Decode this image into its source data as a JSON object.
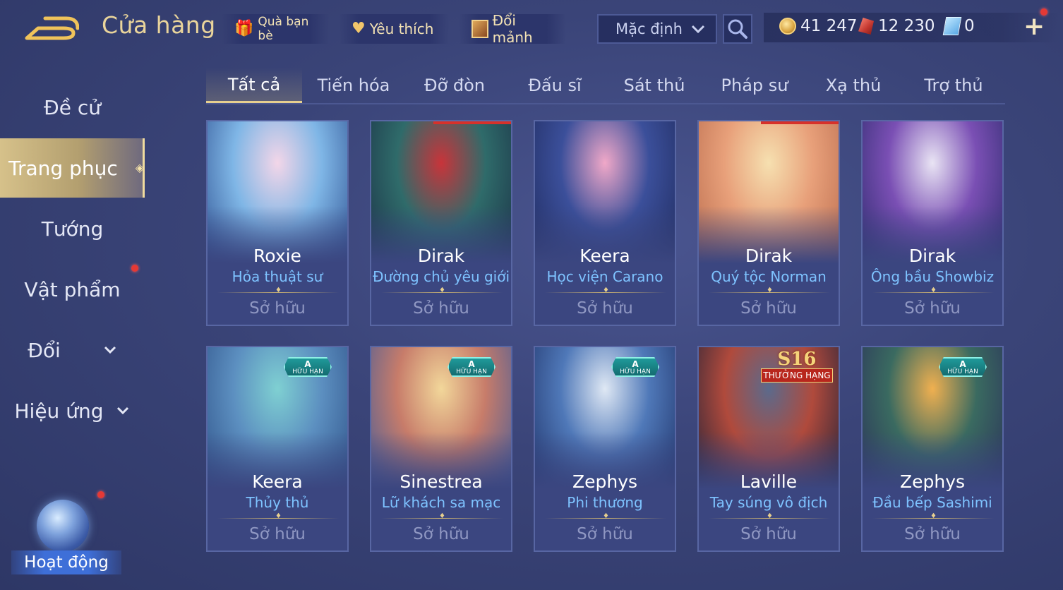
{
  "header": {
    "title": "Cửa hàng",
    "gift_label": "Quà bạn bè",
    "favorite_label": "Yêu thích",
    "fragment_label": "Đổi mảnh",
    "sort": {
      "selected": "Mặc định"
    },
    "currencies": {
      "gold": "41 247",
      "ruby": "12 230",
      "voucher": "0"
    }
  },
  "sidebar": {
    "items": [
      {
        "label": "Đề cử"
      },
      {
        "label": "Trang phục"
      },
      {
        "label": "Tướng"
      },
      {
        "label": "Vật phẩm"
      },
      {
        "label": "Đổi"
      },
      {
        "label": "Hiệu ứng"
      }
    ],
    "activity_label": "Hoạt động"
  },
  "tabs": [
    "Tất cả",
    "Tiến hóa",
    "Đỡ đòn",
    "Đấu sĩ",
    "Sát thủ",
    "Pháp sư",
    "Xạ thủ",
    "Trợ thủ"
  ],
  "badges": {
    "limited_top": "A",
    "limited_bottom": "HỮU HẠN",
    "season": "S16",
    "rank": "THƯỞNG HẠNG"
  },
  "cards": [
    {
      "hero": "Roxie",
      "skin": "Hỏa thuật sư",
      "status": "Sở hữu",
      "palette": [
        "#f3d6e8",
        "#7fb6e6",
        "#2c4e8f"
      ]
    },
    {
      "hero": "Dirak",
      "skin": "Đường chủ yêu giới",
      "status": "Sở hữu",
      "palette": [
        "#c8343a",
        "#2f6b6a",
        "#1a2f45"
      ]
    },
    {
      "hero": "Keera",
      "skin": "Học viện Carano",
      "status": "Sở hữu",
      "palette": [
        "#f0a8c8",
        "#3b4f9a",
        "#1f2a5c"
      ]
    },
    {
      "hero": "Dirak",
      "skin": "Quý tộc Norman",
      "status": "Sở hữu",
      "palette": [
        "#f6e0b0",
        "#e8a07a",
        "#b86a4c"
      ]
    },
    {
      "hero": "Dirak",
      "skin": "Ông bầu Showbiz",
      "status": "Sở hữu",
      "palette": [
        "#e9e4f4",
        "#7a4fb4",
        "#2a2a6a"
      ]
    },
    {
      "hero": "Keera",
      "skin": "Thủy thủ",
      "status": "Sở hữu",
      "palette": [
        "#7fd0d2",
        "#5c8fc0",
        "#2d4f86"
      ]
    },
    {
      "hero": "Sinestrea",
      "skin": "Lữ khách sa mạc",
      "status": "Sở hữu",
      "palette": [
        "#f2d79a",
        "#c77c6a",
        "#3d5a9c"
      ]
    },
    {
      "hero": "Zephys",
      "skin": "Phi thương",
      "status": "Sở hữu",
      "palette": [
        "#dfe8f4",
        "#4f78b8",
        "#1e3066"
      ]
    },
    {
      "hero": "Laville",
      "skin": "Tay súng vô địch",
      "status": "Sở hữu",
      "palette": [
        "#5b6a8c",
        "#b04a3c",
        "#1a2038"
      ]
    },
    {
      "hero": "Zephys",
      "skin": "Đầu bếp Sashimi",
      "status": "Sở hữu",
      "palette": [
        "#f0b050",
        "#3a6a60",
        "#2a2f5a"
      ]
    }
  ]
}
